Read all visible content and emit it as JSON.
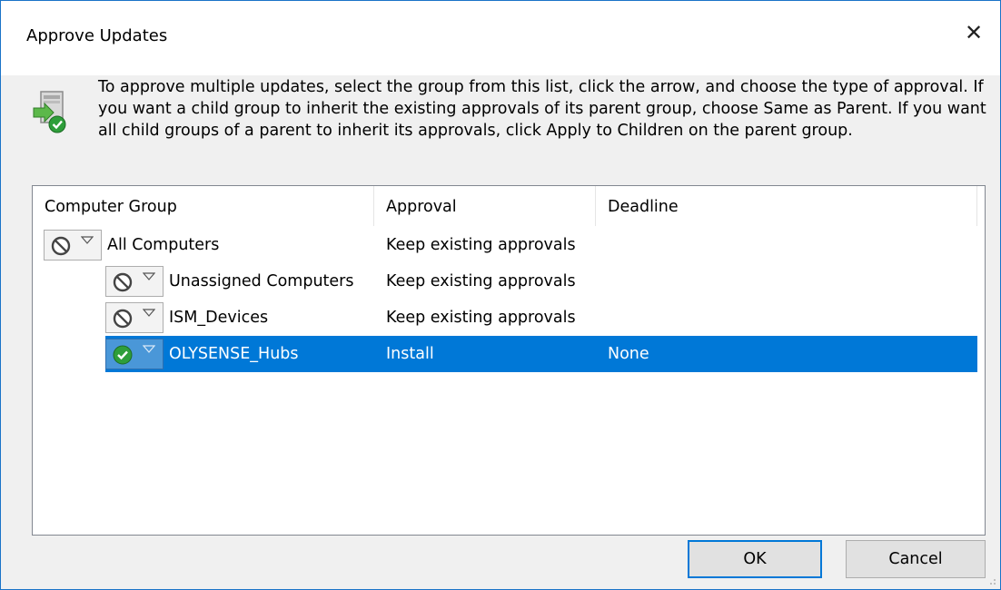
{
  "window": {
    "title": "Approve Updates",
    "close_glyph": "✕"
  },
  "instructions": "To approve multiple updates, select the group from this list, click the arrow, and choose the type of approval. If you want a child group to inherit the existing approvals of its parent group, choose Same as Parent. If you want all child groups of a parent to inherit its approvals, click Apply to Children on the parent group.",
  "columns": [
    "Computer Group",
    "Approval",
    "Deadline"
  ],
  "rows": [
    {
      "group": "All Computers",
      "approval": "Keep existing approvals",
      "deadline": "",
      "status_icon": "not-approved-icon",
      "selected": false,
      "indent": 0
    },
    {
      "group": "Unassigned Computers",
      "approval": "Keep existing approvals",
      "deadline": "",
      "status_icon": "not-approved-icon",
      "selected": false,
      "indent": 1
    },
    {
      "group": "ISM_Devices",
      "approval": "Keep existing approvals",
      "deadline": "",
      "status_icon": "not-approved-icon",
      "selected": false,
      "indent": 1
    },
    {
      "group": "OLYSENSE_Hubs",
      "approval": "Install",
      "deadline": "None",
      "status_icon": "install-approved-icon",
      "selected": true,
      "indent": 1
    }
  ],
  "buttons": {
    "ok": "OK",
    "cancel": "Cancel"
  },
  "colors": {
    "accent": "#0078d7",
    "selection": "#0078d7",
    "approved_green": "#2e9e3a"
  }
}
